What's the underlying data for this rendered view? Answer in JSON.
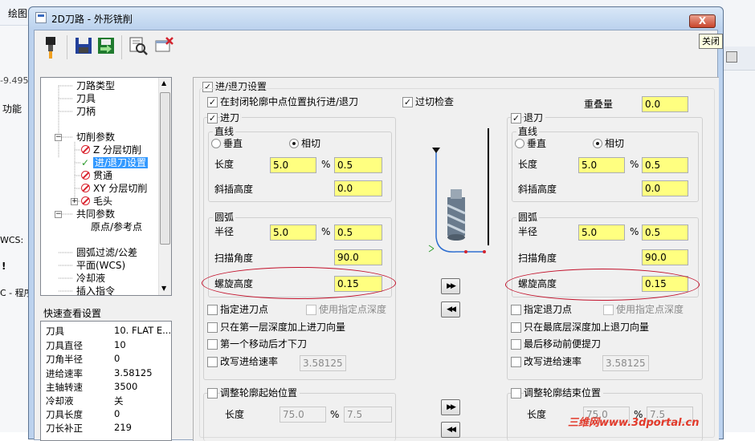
{
  "background_app": {
    "menu_text": "绘图",
    "left_texts": [
      "-9.495",
      "功能",
      "WCS:",
      "!",
      "C - 程序"
    ]
  },
  "window": {
    "title": "2D刀路 - 外形铣削",
    "close_glyph": "X",
    "tooltip": "关闭"
  },
  "toolbar": {
    "icons": [
      "tool-holder-icon",
      "save-icon",
      "export-icon",
      "preview-icon",
      "delete-icon"
    ]
  },
  "tree": {
    "items": [
      {
        "label": "刀路类型"
      },
      {
        "label": "刀具"
      },
      {
        "label": "刀柄"
      },
      {
        "label": "切削参数"
      },
      {
        "label": "Z 分层切削"
      },
      {
        "label": "进/退刀设置"
      },
      {
        "label": "贯通"
      },
      {
        "label": "XY 分层切削"
      },
      {
        "label": "毛头"
      },
      {
        "label": "共同参数"
      },
      {
        "label": "原点/参考点"
      },
      {
        "label": "圆弧过滤/公差"
      },
      {
        "label": "平面(WCS)"
      },
      {
        "label": "冷却液"
      },
      {
        "label": "插入指令"
      }
    ]
  },
  "quickview": {
    "title": "快速查看设置",
    "rows": [
      {
        "label": "刀具",
        "value": "10. FLAT E..."
      },
      {
        "label": "刀具直径",
        "value": "10"
      },
      {
        "label": "刀角半径",
        "value": "0"
      },
      {
        "label": "进给速率",
        "value": "3.58125"
      },
      {
        "label": "主轴转速",
        "value": "3500"
      },
      {
        "label": "冷却液",
        "value": "关"
      },
      {
        "label": "刀具长度",
        "value": "0"
      },
      {
        "label": "刀长补正",
        "value": "219"
      }
    ]
  },
  "main": {
    "enable_label": "进/退刀设置",
    "closed_contour_label": "在封闭轮廓中点位置执行进/退刀",
    "gouge_check_label": "过切检查",
    "overlap_label": "重叠量",
    "overlap_value": "0.0",
    "entry": {
      "title": "进刀",
      "line_title": "直线",
      "perpendicular": "垂直",
      "tangent": "相切",
      "length_label": "长度",
      "length_value": "5.0",
      "percent": "%",
      "length_pct": "0.5",
      "ramp_label": "斜插高度",
      "ramp_value": "0.0",
      "arc_title": "圆弧",
      "radius_label": "半径",
      "radius_value": "5.0",
      "radius_pct": "0.5",
      "sweep_label": "扫描角度",
      "sweep_value": "90.0",
      "helix_label": "螺旋高度",
      "helix_value": "0.15",
      "specify_point": "指定进刀点",
      "use_point_depth": "使用指定点深度",
      "first_depth_only": "只在第一层深度加上进刀向量",
      "first_move_plunge": "第一个移动后才下刀",
      "override_feed": "改写进给速率",
      "feed_value": "3.58125",
      "adjust_start": "调整轮廓起始位置",
      "adjust_length_label": "长度",
      "adjust_length": "75.0",
      "adjust_pct": "7.5"
    },
    "exit": {
      "title": "退刀",
      "line_title": "直线",
      "perpendicular": "垂直",
      "tangent": "相切",
      "length_label": "长度",
      "length_value": "5.0",
      "percent": "%",
      "length_pct": "0.5",
      "ramp_label": "斜插高度",
      "ramp_value": "0.0",
      "arc_title": "圆弧",
      "radius_label": "半径",
      "radius_value": "5.0",
      "radius_pct": "0.5",
      "sweep_label": "扫描角度",
      "sweep_value": "90.0",
      "helix_label": "螺旋高度",
      "helix_value": "0.15",
      "specify_point": "指定退刀点",
      "use_point_depth": "使用指定点深度",
      "last_depth_only": "只在最底层深度加上退刀向量",
      "last_move_lift": "最后移动前便提刀",
      "override_feed": "改写进给速率",
      "feed_value": "3.58125",
      "adjust_end": "调整轮廓结束位置",
      "adjust_length_label": "长度",
      "adjust_length": "75.0",
      "adjust_pct": "7.5"
    },
    "copy_right_glyph": "▶▶",
    "copy_left_glyph": "◀◀"
  },
  "watermark": "三维网www.3dportal.cn"
}
